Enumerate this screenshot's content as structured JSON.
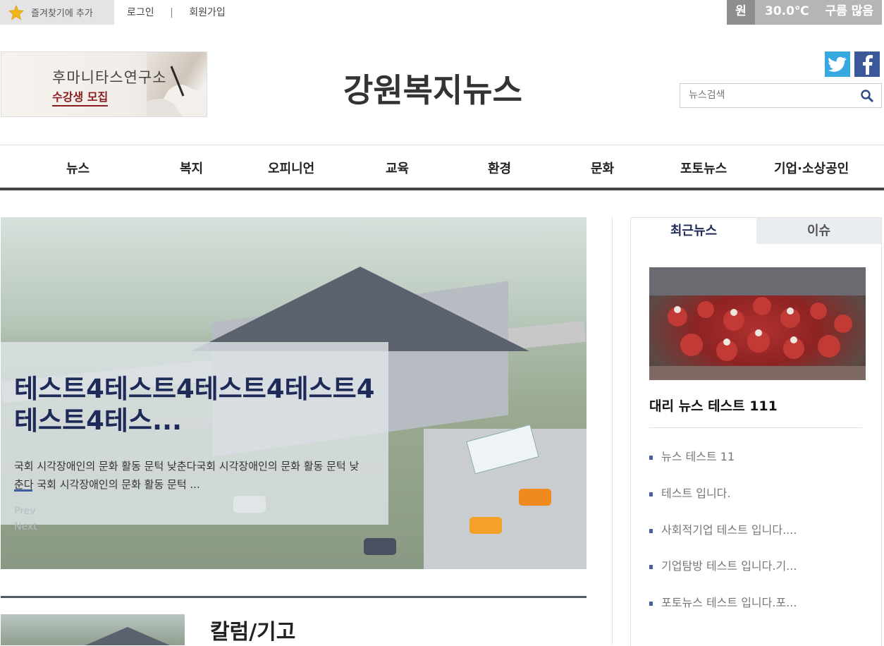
{
  "topbar": {
    "bookmark_label": "즐겨찾기에 추가",
    "login": "로그인",
    "separator": "|",
    "signup": "회원가입",
    "weather": {
      "city": "원주",
      "temp": "30.0℃",
      "condition": "구름 많음"
    }
  },
  "header": {
    "banner": {
      "line1": "후마니타스연구소",
      "line2": "수강생 모집"
    },
    "logo": "강원복지뉴스",
    "search_placeholder": "뉴스검색",
    "social": [
      "twitter-icon",
      "facebook-icon"
    ]
  },
  "nav": [
    "뉴스",
    "복지",
    "오피니언",
    "교육",
    "환경",
    "문화",
    "포토뉴스",
    "기업·소상공인"
  ],
  "slider": {
    "title": "테스트4테스트4테스트4테스트4테스트4테스...",
    "description": "국회 시각장애인의 문화 활동 문턱 낮춘다국회 시각장애인의 문화 활동 문턱 낮춘다  국회 시각장애인의 문화 활동 문턱 ...",
    "prev": "Prev",
    "next": "Next"
  },
  "column_section": {
    "title": "칼럼/기고"
  },
  "sidebar": {
    "tabs": [
      "최근뉴스",
      "이슈"
    ],
    "featured_title": "대리 뉴스 테스트 111",
    "items": [
      "뉴스 테스트 11",
      "테스트 입니다.",
      "사회적기업 테스트 입니다....",
      "기업탐방 테스트 입니다.기...",
      "포토뉴스 테스트 입니다.포..."
    ]
  },
  "colors": {
    "accent": "#1e2a57",
    "nav_border": "#444444",
    "bullet": "#4a5fa3"
  }
}
